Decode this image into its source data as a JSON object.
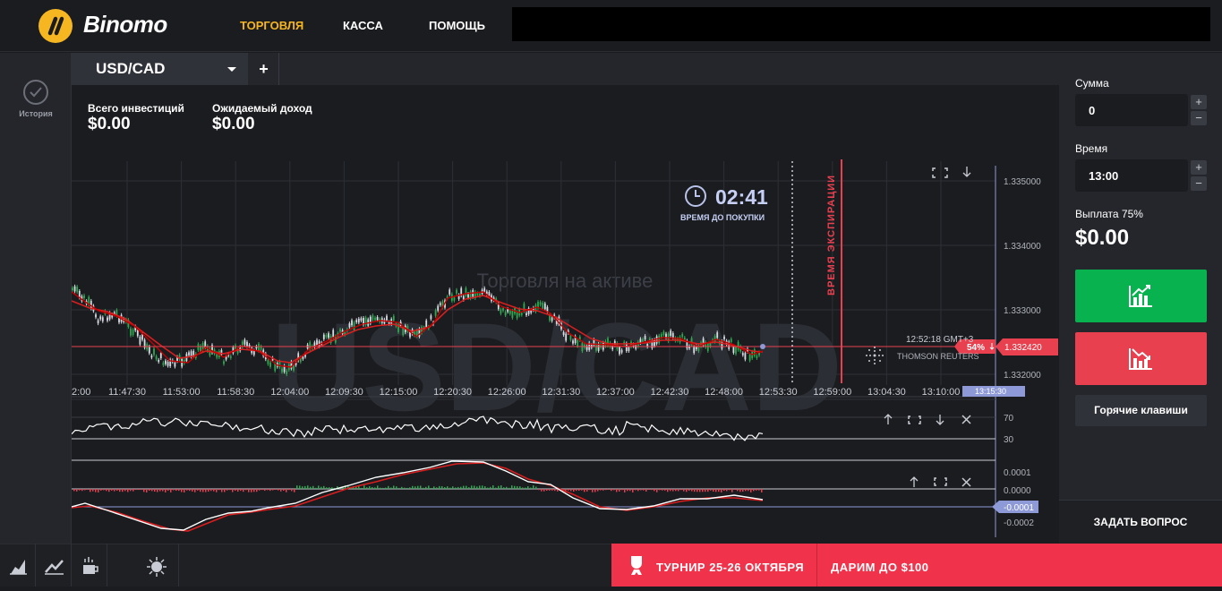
{
  "header": {
    "logo_text": "Binomo",
    "nav": [
      {
        "label": "ТОРГОВЛЯ",
        "active": true
      },
      {
        "label": "КАССА",
        "active": false
      },
      {
        "label": "ПОМОЩЬ",
        "active": false
      }
    ],
    "active_color": "#f5b622"
  },
  "sidebar": {
    "history_label": "История"
  },
  "tabs": {
    "asset": "USD/CAD",
    "add": "+"
  },
  "stats": {
    "invest_label": "Всего инвестиций",
    "invest_value": "$0.00",
    "income_label": "Ожидаемый доход",
    "income_value": "$0.00"
  },
  "chart": {
    "watermark_asset": "USD/CAD",
    "watermark_text": "Торговля на активе",
    "timer": "02:41",
    "timer_label": "ВРЕМЯ ДО ПОКУПКИ",
    "expiry_label": "ВРЕМЯ ЭКСПИРАЦИИ",
    "current_time": "12:52:18 GMT+3",
    "current_price": "1.332420",
    "percent": "54%",
    "provider": "THOMSON REUTERS",
    "time_badge": "13:15:30",
    "price_ticks": [
      "1.335000",
      "1.334000",
      "1.333000",
      "1.332000"
    ],
    "time_ticks": [
      "2:00",
      "11:47:30",
      "11:53:00",
      "11:58:30",
      "12:04:00",
      "12:09:30",
      "12:15:00",
      "12:20:30",
      "12:26:00",
      "12:31:30",
      "12:37:00",
      "12:42:30",
      "12:48:00",
      "12:53:30",
      "12:59:00",
      "13:04:30",
      "13:10:00"
    ],
    "rsi_ticks": [
      "70",
      "30"
    ],
    "macd_ticks": [
      "0.0001",
      "0.0000",
      "-0.0001",
      "-0.0002"
    ],
    "macd_badge": "-0.0001",
    "colors": {
      "up": "#2fa84f",
      "down": "#e8404f",
      "ma": "#d81e1e",
      "grid": "#2d2f36"
    }
  },
  "trade": {
    "amount_label": "Сумма",
    "amount_value": "0",
    "time_label": "Время",
    "time_value": "13:00",
    "payout_label": "Выплата 75%",
    "payout_value": "$0.00",
    "hotkeys": "Горячие клавиши",
    "ask": "ЗАДАТЬ ВОПРОС",
    "up_color": "#08b24f",
    "down_color": "#e8404f"
  },
  "promo": {
    "tournament": "ТУРНИР 25-26 ОКТЯБРЯ",
    "gift": "ДАРИМ ДО $100",
    "color": "#f0324a"
  }
}
